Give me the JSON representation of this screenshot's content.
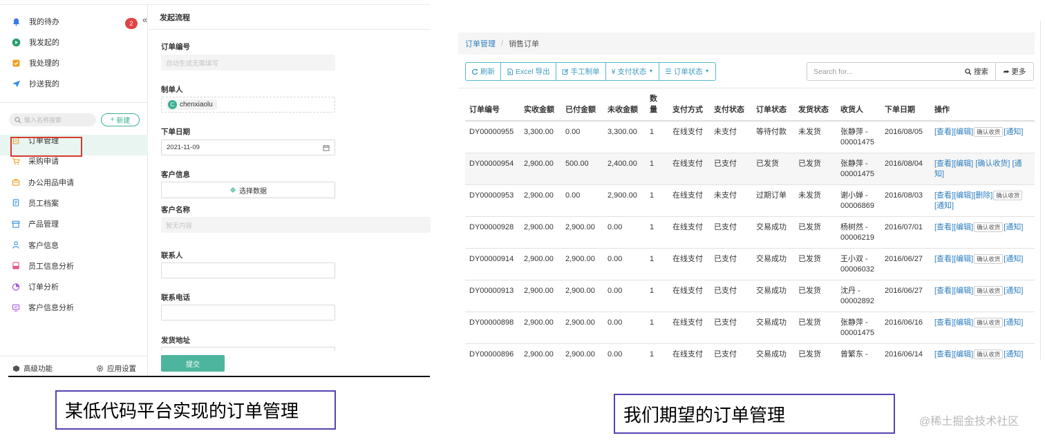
{
  "left": {
    "top_nav": [
      {
        "label": "我的待办",
        "icon": "bell-icon",
        "color": "#3a7be0"
      },
      {
        "label": "我发起的",
        "icon": "play-circle-icon",
        "color": "#28a06a"
      },
      {
        "label": "我处理的",
        "icon": "check-box-icon",
        "color": "#f0a020"
      },
      {
        "label": "抄送我的",
        "icon": "send-icon",
        "color": "#3a8ee0"
      }
    ],
    "badge_count": "2",
    "collapse_icon": "«",
    "search_placeholder": "输入名称搜索",
    "new_button": "新建",
    "menu": [
      {
        "label": "订单管理",
        "icon": "order-icon",
        "color": "#f0a020"
      },
      {
        "label": "采购申请",
        "icon": "cart-icon",
        "color": "#f0a020"
      },
      {
        "label": "办公用品申请",
        "icon": "bag-icon",
        "color": "#f0a020"
      },
      {
        "label": "员工档案",
        "icon": "file-icon",
        "color": "#3a8ee0"
      },
      {
        "label": "产品管理",
        "icon": "store-icon",
        "color": "#3a8ee0"
      },
      {
        "label": "客户信息",
        "icon": "user-icon",
        "color": "#3a8ee0"
      },
      {
        "label": "员工信息分析",
        "icon": "report-icon",
        "color": "#e05a8a"
      },
      {
        "label": "订单分析",
        "icon": "pie-icon",
        "color": "#a45ad8"
      },
      {
        "label": "客户信息分析",
        "icon": "monitor-icon",
        "color": "#a45ad8"
      }
    ],
    "footer": {
      "advanced": "高级功能",
      "settings": "应用设置"
    },
    "form": {
      "title": "发起流程",
      "order_no_label": "订单编号",
      "order_no_placeholder": "自动生成无需填写",
      "creator_label": "制单人",
      "creator_initial": "C",
      "creator_name": "chenxiaolu",
      "date_label": "下单日期",
      "date_value": "2021-11-09",
      "customer_info_label": "客户信息",
      "select_data": "选择数据",
      "customer_name_label": "客户名称",
      "customer_name_placeholder": "暂无内容",
      "contact_label": "联系人",
      "phone_label": "联系电话",
      "address_label": "发货地址",
      "submit": "提交"
    }
  },
  "captions": {
    "left": "某低代码平台实现的订单管理",
    "right": "我们期望的订单管理",
    "watermark": "@稀土掘金技术社区"
  },
  "right": {
    "breadcrumb": [
      "订单管理",
      "销售订单"
    ],
    "toolbar": {
      "refresh": "刷新",
      "excel": "Excel 导出",
      "manual": "手工制单",
      "pay_status": "支付状态",
      "order_status": "订单状态"
    },
    "search_placeholder": "Search for...",
    "search_button": "搜索",
    "more_button": "更多",
    "columns": [
      "订单编号",
      "实收金额",
      "已付金额",
      "未收金额",
      "数量",
      "支付方式",
      "支付状态",
      "订单状态",
      "发货状态",
      "收货人",
      "下单日期",
      "操作"
    ],
    "op_labels": {
      "view": "[查看]",
      "edit": "[编辑]",
      "confirm": "确认收货",
      "confirm_link": "[确认收货]",
      "notify": "[通知]",
      "delete": "[删除]"
    },
    "rows": [
      {
        "id": "DY00000955",
        "received": "3,300.00",
        "paid": "0.00",
        "unpaid": "3,300.00",
        "qty": "1",
        "method": "在线支付",
        "pay": "未支付",
        "status": "等待付款",
        "ship": "未发货",
        "receiver": "张静萍 - 00001475",
        "date": "2016/08/05",
        "ops": "a"
      },
      {
        "id": "DY00000954",
        "received": "2,900.00",
        "paid": "500.00",
        "unpaid": "2,400.00",
        "qty": "1",
        "method": "在线支付",
        "pay": "已支付",
        "status": "已发货",
        "ship": "已发货",
        "receiver": "张静萍 - 00001475",
        "date": "2016/08/04",
        "ops": "b"
      },
      {
        "id": "DY00000953",
        "received": "2,900.00",
        "paid": "0.00",
        "unpaid": "2,900.00",
        "qty": "1",
        "method": "在线支付",
        "pay": "未支付",
        "status": "过期订单",
        "ship": "未发货",
        "receiver": "谢小婵 - 00006869",
        "date": "2016/08/03",
        "ops": "c"
      },
      {
        "id": "DY00000928",
        "received": "2,900.00",
        "paid": "2,900.00",
        "unpaid": "0.00",
        "qty": "1",
        "method": "在线支付",
        "pay": "已支付",
        "status": "交易成功",
        "ship": "已发货",
        "receiver": "杨树然 - 00006219",
        "date": "2016/07/01",
        "ops": "a"
      },
      {
        "id": "DY00000914",
        "received": "2,900.00",
        "paid": "2,900.00",
        "unpaid": "0.00",
        "qty": "1",
        "method": "在线支付",
        "pay": "已支付",
        "status": "交易成功",
        "ship": "已发货",
        "receiver": "王小双 - 00006032",
        "date": "2016/06/27",
        "ops": "a"
      },
      {
        "id": "DY00000913",
        "received": "2,900.00",
        "paid": "2,900.00",
        "unpaid": "0.00",
        "qty": "1",
        "method": "在线支付",
        "pay": "已支付",
        "status": "交易成功",
        "ship": "已发货",
        "receiver": "沈丹 - 00002892",
        "date": "2016/06/27",
        "ops": "a"
      },
      {
        "id": "DY00000898",
        "received": "2,900.00",
        "paid": "2,900.00",
        "unpaid": "0.00",
        "qty": "1",
        "method": "在线支付",
        "pay": "已支付",
        "status": "交易成功",
        "ship": "已发货",
        "receiver": "张静萍 - 00001475",
        "date": "2016/06/16",
        "ops": "a"
      },
      {
        "id": "DY00000896",
        "received": "2,900.00",
        "paid": "2,900.00",
        "unpaid": "0.00",
        "qty": "1",
        "method": "在线支付",
        "pay": "已支付",
        "status": "交易成功",
        "ship": "已发货",
        "receiver": "曾繁东 -",
        "date": "2016/06/14",
        "ops": "a"
      }
    ]
  }
}
